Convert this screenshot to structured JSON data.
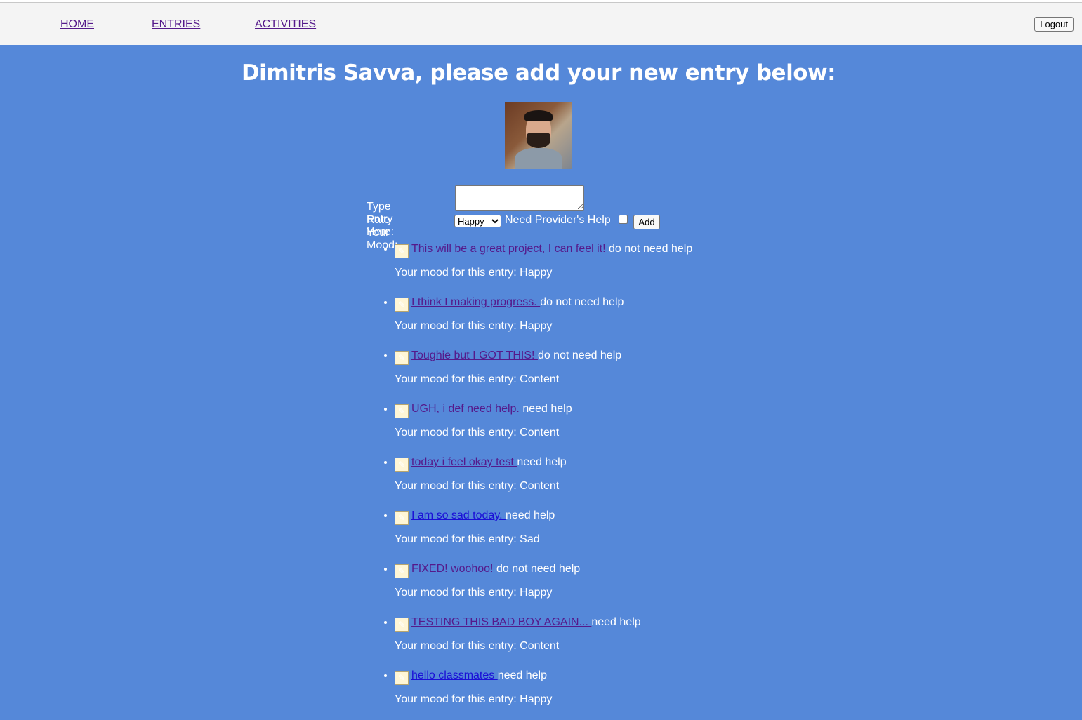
{
  "nav": {
    "home": "HOME",
    "entries": "ENTRIES",
    "activities": "ACTIVITIES",
    "logout": "Logout"
  },
  "page": {
    "title": "Dimitris Savva, please add your new entry below:"
  },
  "form": {
    "entry_label": "Type Entry Here:",
    "entry_value": "",
    "mood_label": "Rate Your Mood:",
    "mood_selected": "Happy",
    "help_label": "Need Provider's Help",
    "help_checked": false,
    "add_label": "Add"
  },
  "entry_icon": "memo-icon",
  "mood_prefix": "Your mood for this entry: ",
  "entries": [
    {
      "text": "This will be a great project, I can feel it! ",
      "help": "do not need help",
      "mood": "Happy",
      "visited": true
    },
    {
      "text": "I think I making progress. ",
      "help": "do not need help",
      "mood": "Happy",
      "visited": true
    },
    {
      "text": "Toughie but I GOT THIS! ",
      "help": "do not need help",
      "mood": "Content",
      "visited": true
    },
    {
      "text": "UGH, i def need help. ",
      "help": "need help",
      "mood": "Content",
      "visited": true
    },
    {
      "text": "today i feel okay test ",
      "help": "need help",
      "mood": "Content",
      "visited": true
    },
    {
      "text": "I am so sad today. ",
      "help": "need help",
      "mood": "Sad",
      "visited": false
    },
    {
      "text": "FIXED! woohoo! ",
      "help": "do not need help",
      "mood": "Happy",
      "visited": true
    },
    {
      "text": "TESTING THIS BAD BOY AGAIN... ",
      "help": "need help",
      "mood": "Content",
      "visited": true
    },
    {
      "text": "hello classmates ",
      "help": "need help",
      "mood": "Happy",
      "visited": false
    }
  ],
  "colors": {
    "background": "#5588d9",
    "navbar": "#f4f4f4",
    "visited_link": "#551a8b",
    "unvisited_link": "#1a0fd6"
  }
}
